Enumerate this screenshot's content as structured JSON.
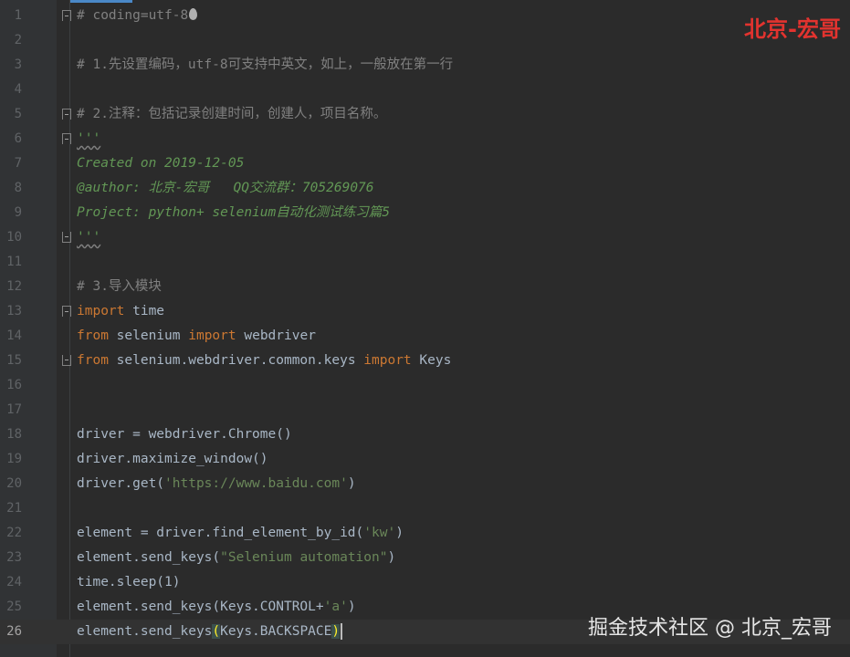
{
  "editor": {
    "lines": [
      {
        "n": "1",
        "fold": "open"
      },
      {
        "n": "2"
      },
      {
        "n": "3"
      },
      {
        "n": "4"
      },
      {
        "n": "5",
        "fold": "open"
      },
      {
        "n": "6",
        "fold": "open"
      },
      {
        "n": "7"
      },
      {
        "n": "8"
      },
      {
        "n": "9"
      },
      {
        "n": "10",
        "fold": "close"
      },
      {
        "n": "11"
      },
      {
        "n": "12"
      },
      {
        "n": "13",
        "fold": "open"
      },
      {
        "n": "14"
      },
      {
        "n": "15",
        "fold": "close"
      },
      {
        "n": "16"
      },
      {
        "n": "17"
      },
      {
        "n": "18"
      },
      {
        "n": "19"
      },
      {
        "n": "20"
      },
      {
        "n": "21"
      },
      {
        "n": "22"
      },
      {
        "n": "23"
      },
      {
        "n": "24"
      },
      {
        "n": "25"
      },
      {
        "n": "26",
        "current": true
      }
    ],
    "code": {
      "l1": "# coding=utf-8",
      "l3": "# 1.先设置编码，utf-8可支持中英文，如上，一般放在第一行",
      "l5": "# 2.注释：包括记录创建时间，创建人，项目名称。",
      "l6": "'''",
      "l7": "Created on 2019-12-05",
      "l8": "@author: 北京-宏哥   QQ交流群：705269076",
      "l9": "Project: python+ selenium自动化测试练习篇5",
      "l10": "'''",
      "l12": "# 3.导入模块",
      "l13_kw": "import",
      "l13_rest": " time",
      "l14_kw1": "from",
      "l14_mid": " selenium ",
      "l14_kw2": "import",
      "l14_rest": " webdriver",
      "l15_kw1": "from",
      "l15_mid": " selenium.webdriver.common.keys ",
      "l15_kw2": "import",
      "l15_rest": " Keys",
      "l18": "driver = webdriver.Chrome()",
      "l19": "driver.maximize_window()",
      "l20_a": "driver.get(",
      "l20_s": "'https://www.baidu.com'",
      "l20_b": ")",
      "l22_a": "element = driver.find_element_by_id(",
      "l22_s": "'kw'",
      "l22_b": ")",
      "l23_a": "element.send_keys(",
      "l23_s": "\"Selenium automation\"",
      "l23_b": ")",
      "l24": "time.sleep(1)",
      "l25_a": "element.send_keys(Keys.CONTROL+",
      "l25_s": "'a'",
      "l25_b": ")",
      "l26_a": "element.send_keys",
      "l26_p1": "(",
      "l26_mid": "Keys.BACKSPACE",
      "l26_p2": ")"
    }
  },
  "watermarks": {
    "top": "北京-宏哥",
    "bottom": "掘金技术社区 @ 北京_宏哥"
  },
  "colors": {
    "background": "#2b2b2b",
    "gutter": "#313335",
    "keyword": "#cc7832",
    "comment": "#808080",
    "docstring": "#629755",
    "string": "#6a8759",
    "text": "#a9b7c6",
    "watermark_top": "#e2332f"
  },
  "icons": {
    "line1_trailing": "flame-icon"
  }
}
